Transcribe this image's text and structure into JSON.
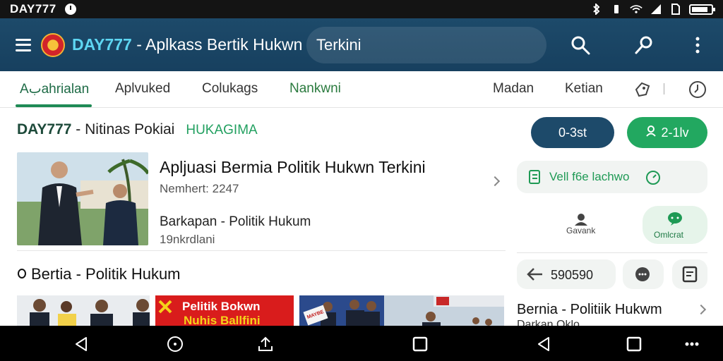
{
  "status_bar": {
    "carrier": "DAY777",
    "icons": [
      "alarm-icon",
      "bluetooth-icon",
      "wifi-icon",
      "signal-icon",
      "battery-icon"
    ]
  },
  "app_bar": {
    "brand": "DAY777",
    "title_rest": "- Aplkass Bertik Hukwn",
    "search_text": "Terkini",
    "icons": [
      "menu-icon",
      "search-icon",
      "key-icon",
      "more-vert-icon"
    ]
  },
  "tabs": {
    "items": [
      "Aبahrialan",
      "Aplvuked",
      "Colukags",
      "Nankwni",
      "Madan",
      "Ketian"
    ],
    "active_index": 0
  },
  "section": {
    "brand": "DAY777",
    "title": " - Nitinas Pokiai",
    "tag": "HUKAGIMA"
  },
  "right_panel": {
    "btn_primary": "0-3st",
    "btn_secondary": "2-1lv",
    "card_label": "Vell f6e lachwo",
    "user_label": "Gavank",
    "contact_label": "Omlcrat",
    "share_count": "590590",
    "bottom_title": "Bernia - Politiik Hukwm",
    "bottom_sub": "Darkan Oklo"
  },
  "article": {
    "title": "Apljuasi Bermia Politik Hukwn Terkini",
    "meta": "Nemhert: 2247",
    "subtitle": "Barkapan - Politik Hukum",
    "sub_meta": "19nkrdlani"
  },
  "section2": {
    "title": "Bertia - Politik Hukum"
  },
  "gallery": {
    "banner_line1": "Pelitik Bokwn",
    "banner_line2": "Nuhis Ballfini",
    "placard": "MAYBE"
  },
  "colors": {
    "app_bar": "#1d4a6a",
    "accent_green": "#1f8a55",
    "btn_primary": "#1d4a6a",
    "btn_secondary": "#22a860",
    "banner_red": "#d91c1c"
  }
}
